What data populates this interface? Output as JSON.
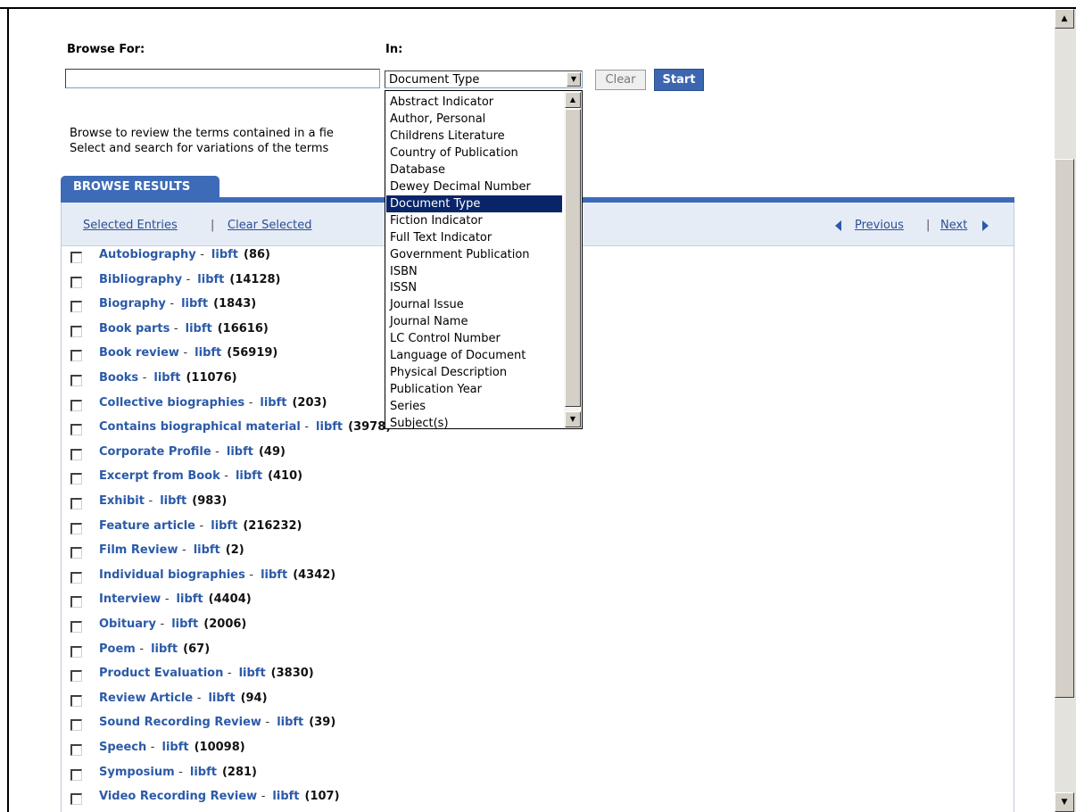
{
  "form": {
    "browse_label": "Browse For:",
    "in_label": "In:",
    "browse_value": "",
    "selected_field": "Document Type",
    "clear_label": "Clear",
    "start_label": "Start"
  },
  "help": {
    "line1": "Browse to review the terms contained in a fie",
    "line2": "Select and search for variations of the terms"
  },
  "results": {
    "tab_label": "BROWSE RESULTS",
    "selected_entries": "Selected Entries",
    "separator": "|",
    "clear_selected": "Clear Selected",
    "previous": "Previous",
    "next": "Next",
    "dash": "-",
    "items": [
      {
        "term": "Autobiography",
        "source": "libft",
        "count": "(86)"
      },
      {
        "term": "Bibliography",
        "source": "libft",
        "count": "(14128)"
      },
      {
        "term": "Biography",
        "source": "libft",
        "count": "(1843)"
      },
      {
        "term": "Book parts",
        "source": "libft",
        "count": "(16616)"
      },
      {
        "term": "Book review",
        "source": "libft",
        "count": "(56919)"
      },
      {
        "term": "Books",
        "source": "libft",
        "count": "(11076)"
      },
      {
        "term": "Collective biographies",
        "source": "libft",
        "count": "(203)"
      },
      {
        "term": "Contains biographical material",
        "source": "libft",
        "count": "(3978)"
      },
      {
        "term": "Corporate Profile",
        "source": "libft",
        "count": "(49)"
      },
      {
        "term": "Excerpt from Book",
        "source": "libft",
        "count": "(410)"
      },
      {
        "term": "Exhibit",
        "source": "libft",
        "count": "(983)"
      },
      {
        "term": "Feature article",
        "source": "libft",
        "count": "(216232)"
      },
      {
        "term": "Film Review",
        "source": "libft",
        "count": "(2)"
      },
      {
        "term": "Individual biographies",
        "source": "libft",
        "count": "(4342)"
      },
      {
        "term": "Interview",
        "source": "libft",
        "count": "(4404)"
      },
      {
        "term": "Obituary",
        "source": "libft",
        "count": "(2006)"
      },
      {
        "term": "Poem",
        "source": "libft",
        "count": "(67)"
      },
      {
        "term": "Product Evaluation",
        "source": "libft",
        "count": "(3830)"
      },
      {
        "term": "Review Article",
        "source": "libft",
        "count": "(94)"
      },
      {
        "term": "Sound Recording Review",
        "source": "libft",
        "count": "(39)"
      },
      {
        "term": "Speech",
        "source": "libft",
        "count": "(10098)"
      },
      {
        "term": "Symposium",
        "source": "libft",
        "count": "(281)"
      },
      {
        "term": "Video Recording Review",
        "source": "libft",
        "count": "(107)"
      }
    ]
  },
  "dropdown": {
    "options": [
      "Abstract Indicator",
      "Author, Personal",
      "Childrens Literature",
      "Country of Publication",
      "Database",
      "Dewey Decimal Number",
      "Document Type",
      "Fiction Indicator",
      "Full Text Indicator",
      "Government Publication",
      "ISBN",
      "ISSN",
      "Journal Issue",
      "Journal Name",
      "LC Control Number",
      "Language of Document",
      "Physical Description",
      "Publication Year",
      "Series",
      "Subject(s)"
    ],
    "selected_index": 6
  },
  "icons": {
    "previous": "triangle-left-icon",
    "next": "triangle-right-icon",
    "select_arrow": "chevron-down-icon"
  },
  "colors": {
    "accent": "#3d6bb8",
    "link": "#2b5aa8",
    "highlight": "#0a246a",
    "bar": "#e6ecf6"
  }
}
